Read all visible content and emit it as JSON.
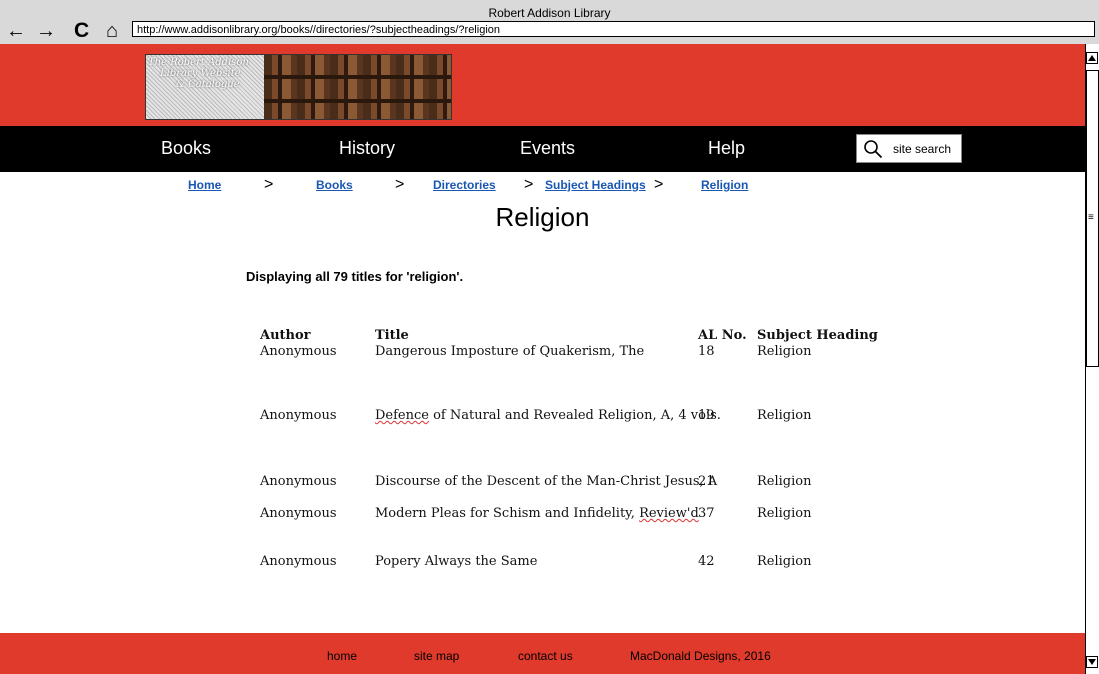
{
  "browser": {
    "window_title": "Robert Addison Library",
    "back_icon": "←",
    "forward_icon": "→",
    "reload_icon": "C",
    "home_icon": "⌂",
    "url": "http://www.addisonlibrary.org/books//directories/?subjectheadings/?religion"
  },
  "header": {
    "logo_text": [
      "The Robert Addison",
      "Library Website",
      "& Catalogue"
    ]
  },
  "nav": {
    "items": [
      "Books",
      "History",
      "Events",
      "Help"
    ],
    "search_placeholder": "site search"
  },
  "breadcrumb": {
    "items": [
      "Home",
      "Books",
      "Directories",
      "Subject Headings",
      "Religion"
    ],
    "separator": ">"
  },
  "page": {
    "title": "Religion",
    "display_count": "Displaying all 79 titles for 'religion'."
  },
  "table": {
    "headers": [
      "Author",
      "Title",
      "AL No.",
      "Subject Heading"
    ],
    "rows": [
      {
        "author": "Anonymous",
        "title": "Dangerous Imposture of Quakerism, The",
        "al_no": "18",
        "subject": "Religion"
      },
      {
        "author": "Anonymous",
        "title_pre": "",
        "title_flag": "Defence",
        "title_post": " of Natural and Revealed Religion, A, 4 vols.",
        "al_no": "19",
        "subject": "Religion"
      },
      {
        "author": "Anonymous",
        "title": "Discourse of the Descent of the Man-Christ Jesus, A",
        "al_no": "21",
        "subject": "Religion"
      },
      {
        "author": "Anonymous",
        "title_pre": "Modern Pleas for Schism and Infidelity, ",
        "title_flag": "Review'd",
        "title_post": "",
        "al_no": "37",
        "subject": "Religion"
      },
      {
        "author": "Anonymous",
        "title": "Popery Always the Same",
        "al_no": "42",
        "subject": "Religion"
      }
    ]
  },
  "footer": {
    "links": [
      "home",
      "site map",
      "contact us"
    ],
    "credit": "MacDonald Designs, 2016"
  },
  "colors": {
    "brand_red": "#e03a2c",
    "nav_black": "#000000",
    "link_blue": "#1a57b3"
  }
}
